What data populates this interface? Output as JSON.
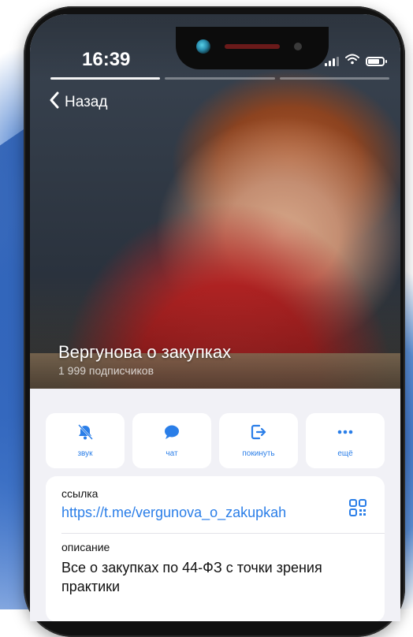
{
  "status_bar": {
    "time": "16:39"
  },
  "nav": {
    "back_label": "Назад"
  },
  "channel": {
    "name": "Вергунова о закупках",
    "subscribers": "1 999 подписчиков"
  },
  "actions": [
    {
      "label": "звук",
      "icon": "bell-muted-icon"
    },
    {
      "label": "чат",
      "icon": "chat-bubble-icon"
    },
    {
      "label": "покинуть",
      "icon": "leave-icon"
    },
    {
      "label": "ещё",
      "icon": "more-dots-icon"
    }
  ],
  "info": {
    "link_label": "ссылка",
    "link": "https://t.me/vergunova_o_zakupkah",
    "description_label": "описание",
    "description": "Все о закупках по 44-ФЗ с точки зрения практики"
  },
  "colors": {
    "accent": "#2a7ee8",
    "background": "#f1f1f6",
    "card": "#ffffff"
  }
}
